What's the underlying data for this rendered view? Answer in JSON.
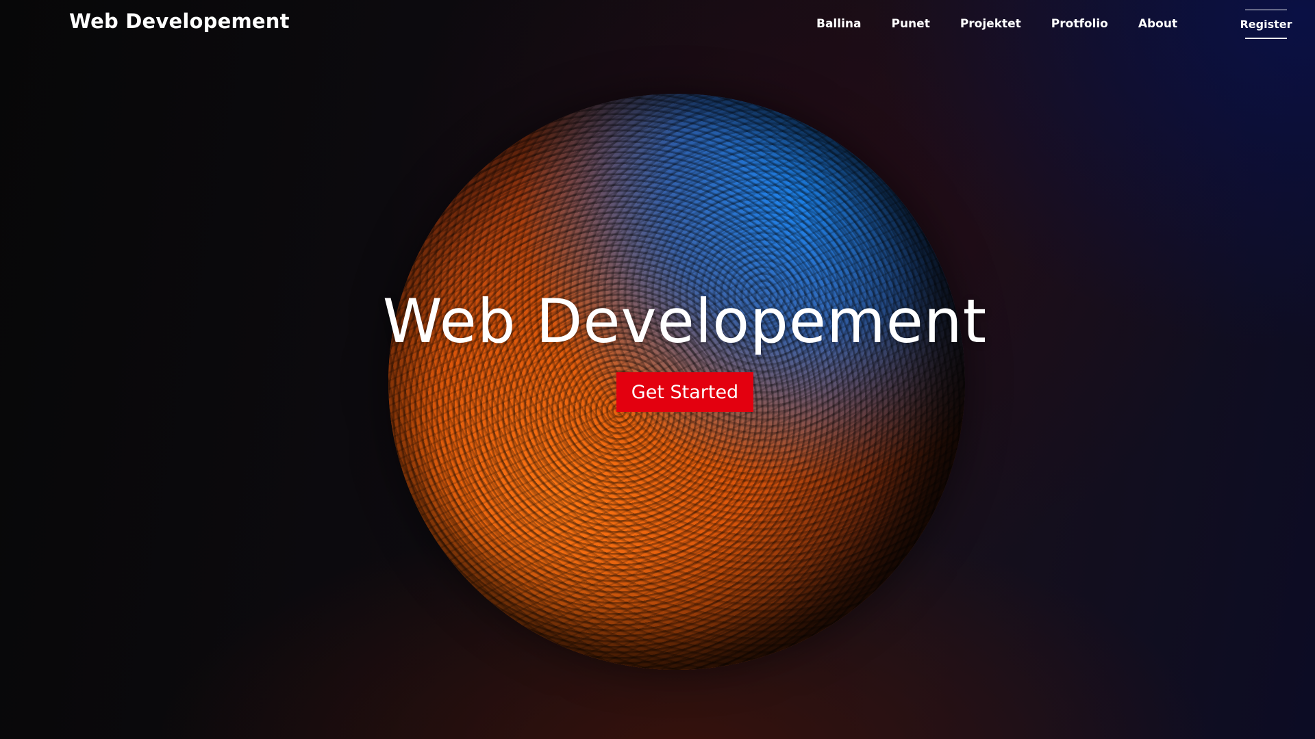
{
  "header": {
    "brand": "Web Developement",
    "nav": {
      "items": [
        {
          "label": "Ballina"
        },
        {
          "label": "Punet"
        },
        {
          "label": "Projektet"
        },
        {
          "label": "Protfolio"
        },
        {
          "label": "About"
        }
      ]
    },
    "register_label": "Register"
  },
  "hero": {
    "title": "Web Developement",
    "cta_label": "Get Started",
    "cta_color": "#e3000f",
    "background_image": "textured-sphere"
  },
  "colors": {
    "accent": "#e3000f",
    "text": "#ffffff",
    "sphere_orange": "#ff7a14",
    "sphere_blue": "#198cff"
  }
}
